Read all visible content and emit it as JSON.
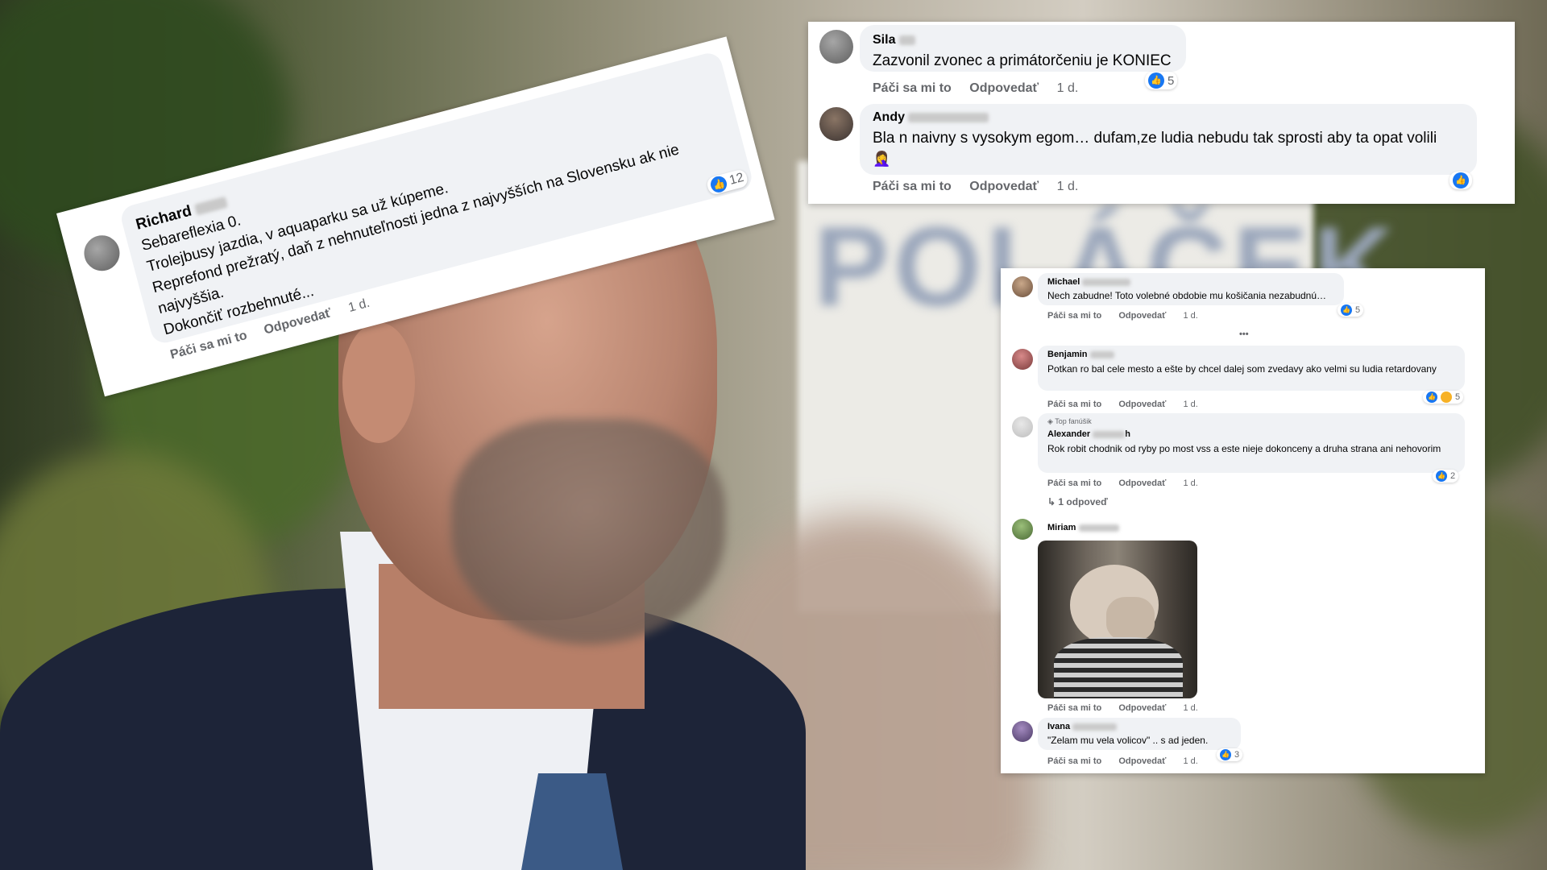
{
  "background": {
    "poster_text": "POLÁČEK"
  },
  "comments_top_left": {
    "name": "Richard",
    "lines": [
      "Sebareflexia 0.",
      "Trolejbusy jazdia, v aquaparku sa už kúpeme.",
      "Reprefond prežratý, daň z nehnuteľnosti jedna z najvyšších na Slovensku ak nie",
      "najvyššia.",
      "Dokončiť rozbehnuté..."
    ],
    "reactions": "12",
    "like_label": "Páči sa mi to",
    "reply_label": "Odpovedať",
    "age": "1 d."
  },
  "comments_top_right": [
    {
      "name": "Sila",
      "text": "Zazvonil zvonec a primátorčeniu je KONIEC",
      "reactions": "5",
      "like_label": "Páči sa mi to",
      "reply_label": "Odpovedať",
      "age": "1 d."
    },
    {
      "name": "Andy",
      "text": "Bla   n naivny s vysokym egom… dufam,ze ludia nebudu tak sprosti aby ta opat volili",
      "emoji": "🤦‍♀️",
      "like_label": "Páči sa mi to",
      "reply_label": "Odpovedať",
      "age": "1 d."
    }
  ],
  "comments_bottom_right": {
    "items": [
      {
        "name": "Michael",
        "text": "Nech zabudne! Toto volebné obdobie mu košičania nezabudnú…",
        "reactions": "5",
        "like_label": "Páči sa mi to",
        "reply_label": "Odpovedať",
        "age": "1 d."
      },
      {
        "name": "Benjamin",
        "text": "Potkan ro   bal cele mesto a ešte by chcel dalej som zvedavy ako velmi su ludia retardovany",
        "reactions": "5",
        "like_label": "Páči sa mi to",
        "reply_label": "Odpovedať",
        "age": "1 d."
      },
      {
        "badge": "Top fanúšik",
        "name": "Alexander",
        "name_tail": "h",
        "text": "Rok robit chodnik od ryby po most vss a este nieje dokonceny a druha strana ani nehovorim",
        "reactions": "2",
        "like_label": "Páči sa mi to",
        "reply_label": "Odpovedať",
        "age": "1 d.",
        "replies": "1 odpoveď"
      },
      {
        "name": "Miriam",
        "like_label": "Páči sa mi to",
        "reply_label": "Odpovedať",
        "age": "1 d."
      },
      {
        "name": "Ivana",
        "text": "\"Zelam mu vela volicov\" .. s    ad jeden.",
        "reactions": "3",
        "like_label": "Páči sa mi to",
        "reply_label": "Odpovedať",
        "age": "1 d."
      }
    ],
    "more": "•••"
  },
  "colors": {
    "like_blue": "#1877f2",
    "meta_gray": "#65676b",
    "bubble_gray": "#f0f2f5"
  },
  "icons": [
    "like-icon",
    "haha-icon",
    "reply-arrow-icon",
    "top-fan-icon"
  ]
}
